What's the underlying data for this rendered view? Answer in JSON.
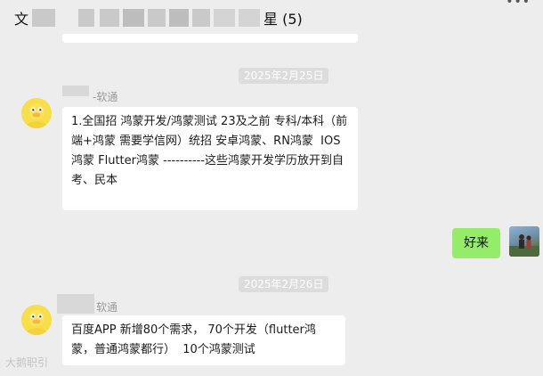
{
  "header": {
    "title_prefix": "文",
    "title_suffix": "星 (5)",
    "more_icon": "more-dots-icon"
  },
  "messages": [
    {
      "date": "2025年2月25日",
      "sender_tag": "-软通",
      "text": "1.全国招 鸿蒙开发/鸿蒙测试 23及之前 专科/本科（前端+鸿蒙 需要学信网）统招 安卓鸿蒙、RN鸿蒙  IOS鸿蒙 Flutter鸿蒙 ----------这些鸿蒙开发学历放开到自考、民本"
    },
    {
      "self_text": "好来"
    },
    {
      "date": "2025年2月26日",
      "sender_tag": "软通",
      "text": "百度APP 新增80个需求， 70个开发（flutter鸿蒙，普通鸿蒙都行）  10个鸿蒙测试"
    }
  ],
  "watermark": "大鹅职引",
  "colors": {
    "background": "#ededed",
    "bubble_incoming": "#ffffff",
    "bubble_outgoing": "#95ec69",
    "date_badge": "#dcdcdc"
  }
}
